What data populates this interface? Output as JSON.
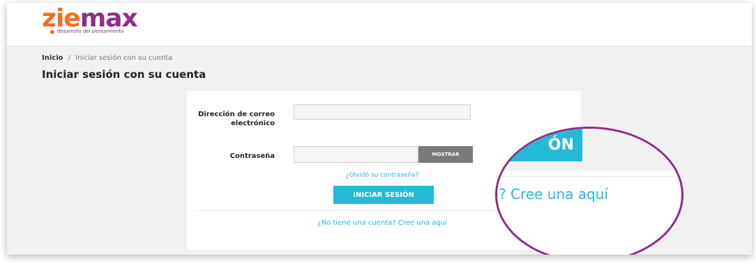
{
  "header": {
    "logo_prefix": "zie",
    "logo_suffix": "max",
    "logo_tagline": "desarrollo del pensamiento"
  },
  "breadcrumb": {
    "home": "Inicio",
    "separator": "/",
    "current": "Iniciar sesión con su cuenta"
  },
  "page_title": "Iniciar sesión con su cuenta",
  "login_form": {
    "email_label": "Dirección de correo electrónico",
    "email_value": "",
    "password_label": "Contraseña",
    "password_value": "",
    "show_button": "MOSTRAR",
    "forgot_link": "¿Olvidó su contraseña?",
    "signin_button": "INICIAR SESIÓN",
    "register_link": "¿No tiene una cuenta? Cree una aquí"
  },
  "magnifier": {
    "button_fragment": "ÓN",
    "text_fragment": "ta? Cree una aquí"
  },
  "colors": {
    "accent": "#24b9d7",
    "brand_purple": "#8a2f86",
    "brand_orange": "#f36f21"
  }
}
